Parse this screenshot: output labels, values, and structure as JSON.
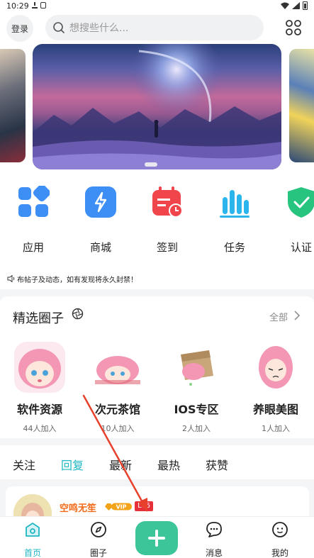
{
  "status_bar": {
    "time": "10:29"
  },
  "header": {
    "login_label": "登录",
    "search_placeholder": "想搜些什么..."
  },
  "quick_menu": [
    {
      "label": "应用",
      "icon": "app-grid-icon",
      "color": "#3d8ef5"
    },
    {
      "label": "商城",
      "icon": "lightning-icon",
      "color": "#3d8ef5"
    },
    {
      "label": "签到",
      "icon": "calendar-icon",
      "color": "#f0454b"
    },
    {
      "label": "任务",
      "icon": "bar-chart-icon",
      "color": "#2ab5ec"
    },
    {
      "label": "认证",
      "icon": "shield-check-icon",
      "color": "#27c480"
    }
  ],
  "notice": {
    "text": "布帖子及动态，如有发现将永久封禁！"
  },
  "circles": {
    "title": "精选圈子",
    "more_label": "全部",
    "items": [
      {
        "name": "软件资源",
        "count": "44人加入"
      },
      {
        "name": "次元茶馆",
        "count": "10人加入"
      },
      {
        "name": "IOS专区",
        "count": "2人加入"
      },
      {
        "name": "养眼美图",
        "count": "1人加入"
      }
    ]
  },
  "tabs": [
    {
      "label": "关注",
      "active": false
    },
    {
      "label": "回复",
      "active": true
    },
    {
      "label": "最新",
      "active": false
    },
    {
      "label": "最热",
      "active": false
    },
    {
      "label": "获赞",
      "active": false
    }
  ],
  "post": {
    "author": "空鸣无笙",
    "vip_label": "VIP",
    "level": "Lv6"
  },
  "bottom_nav": [
    {
      "label": "首页",
      "icon": "home-icon",
      "active": true
    },
    {
      "label": "圈子",
      "icon": "compass-icon",
      "active": false
    },
    {
      "label": "消息",
      "icon": "chat-icon",
      "active": false
    },
    {
      "label": "我的",
      "icon": "user-face-icon",
      "active": false
    }
  ],
  "colors": {
    "accent": "#1fb7c4",
    "plus_button": "#3dc59a",
    "author": "#f36b1a",
    "annotation": "#e8412b"
  }
}
